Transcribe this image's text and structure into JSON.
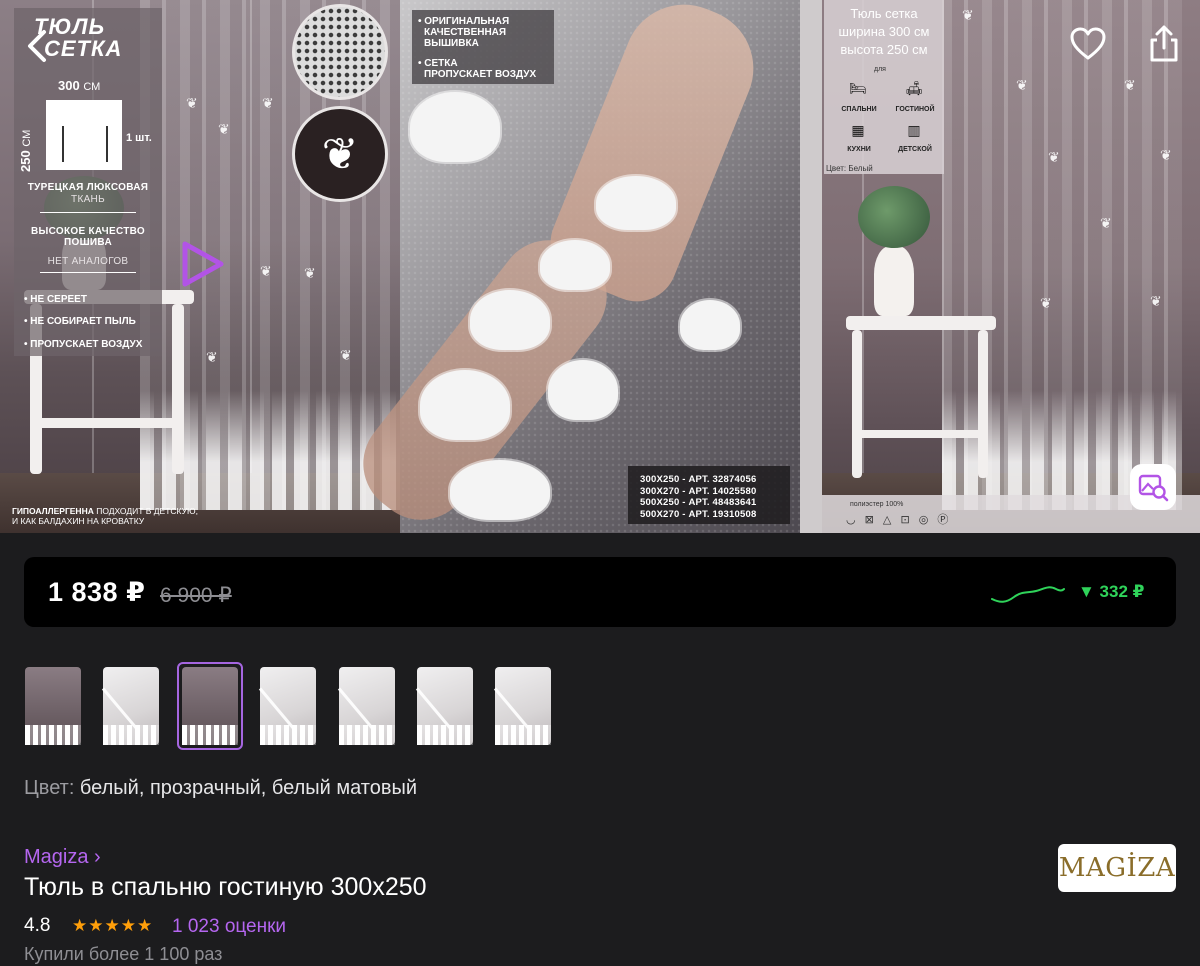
{
  "gallery": {
    "panel1": {
      "brand_line1": "ТЮЛЬ",
      "brand_line2": "СЕТКА",
      "width_value": "300",
      "width_unit": "СМ",
      "height_value": "250",
      "height_unit": "СМ",
      "quantity": "1 шт.",
      "fabric_title": "ТУРЕЦКАЯ ЛЮКСОВАЯ",
      "fabric_sub": "ТКАНЬ",
      "quality_title": "ВЫСОКОЕ КАЧЕСТВО ПОШИВА",
      "quality_sub": "НЕТ АНАЛОГОВ",
      "bullets": [
        "• НЕ СЕРЕЕТ",
        "• НЕ СОБИРАЕТ ПЫЛЬ",
        "• ПРОПУСКАЕТ ВОЗДУХ"
      ],
      "hypo_bold": "ГИПОАЛЛЕРГЕННА",
      "hypo_rest": " ПОДХОДИТ В ДЕТСКУЮ,",
      "hypo_line2": "И КАК БАЛДАХИН НА КРОВАТКУ"
    },
    "panel2": {
      "lines": [
        "• ОРИГИНАЛЬНАЯ",
        "КАЧЕСТВЕННАЯ",
        "ВЫШИВКА",
        "• СЕТКА",
        "ПРОПУСКАЕТ ВОЗДУХ"
      ],
      "articles": [
        "300X250 - АРТ. 32874056",
        "300X270 - АРТ. 14025580",
        "500X250 - АРТ. 48483641",
        "500X270 - АРТ. 19310508"
      ]
    },
    "panel3": {
      "title_lines": [
        "Тюль сетка",
        "ширина 300 см",
        "высота  250 см"
      ],
      "for_label": "для",
      "rooms": [
        "СПАЛЬНИ",
        "ГОСТИНОЙ",
        "КУХНИ",
        "ДЕТСКОЙ"
      ],
      "color_note": "Цвет: Белый",
      "care_text": "полиэстер 100%"
    },
    "icons": {
      "back": "chevron-left-icon",
      "play": "play-icon",
      "favorite": "heart-icon",
      "share": "share-icon",
      "visual_search": "image-search-icon"
    }
  },
  "price": {
    "current": "1 838 ₽",
    "old": "6 900 ₽",
    "drop": "▼ 332 ₽",
    "drop_color": "#2fd35a"
  },
  "thumbnails": [
    {
      "style": "dark",
      "active": false
    },
    {
      "style": "light",
      "active": false
    },
    {
      "style": "dark",
      "active": true
    },
    {
      "style": "light",
      "active": false
    },
    {
      "style": "light",
      "active": false
    },
    {
      "style": "light",
      "active": false
    },
    {
      "style": "light",
      "active": false
    }
  ],
  "details": {
    "color_label": "Цвет:",
    "color_value": " белый, прозрачный, белый матовый",
    "seller": "Magiza ›",
    "title": "Тюль в спальню гостиную 300x250",
    "rating": "4.8",
    "stars": "★★★★★",
    "reviews": "1 023 оценки",
    "bought": "Купили более 1 100 раз",
    "seller_logo": "MAGİZA"
  },
  "colors": {
    "accent": "#b566f0",
    "active_thumb": "#a566e0",
    "star": "#ff9f0a",
    "background": "#1c1c1e"
  }
}
